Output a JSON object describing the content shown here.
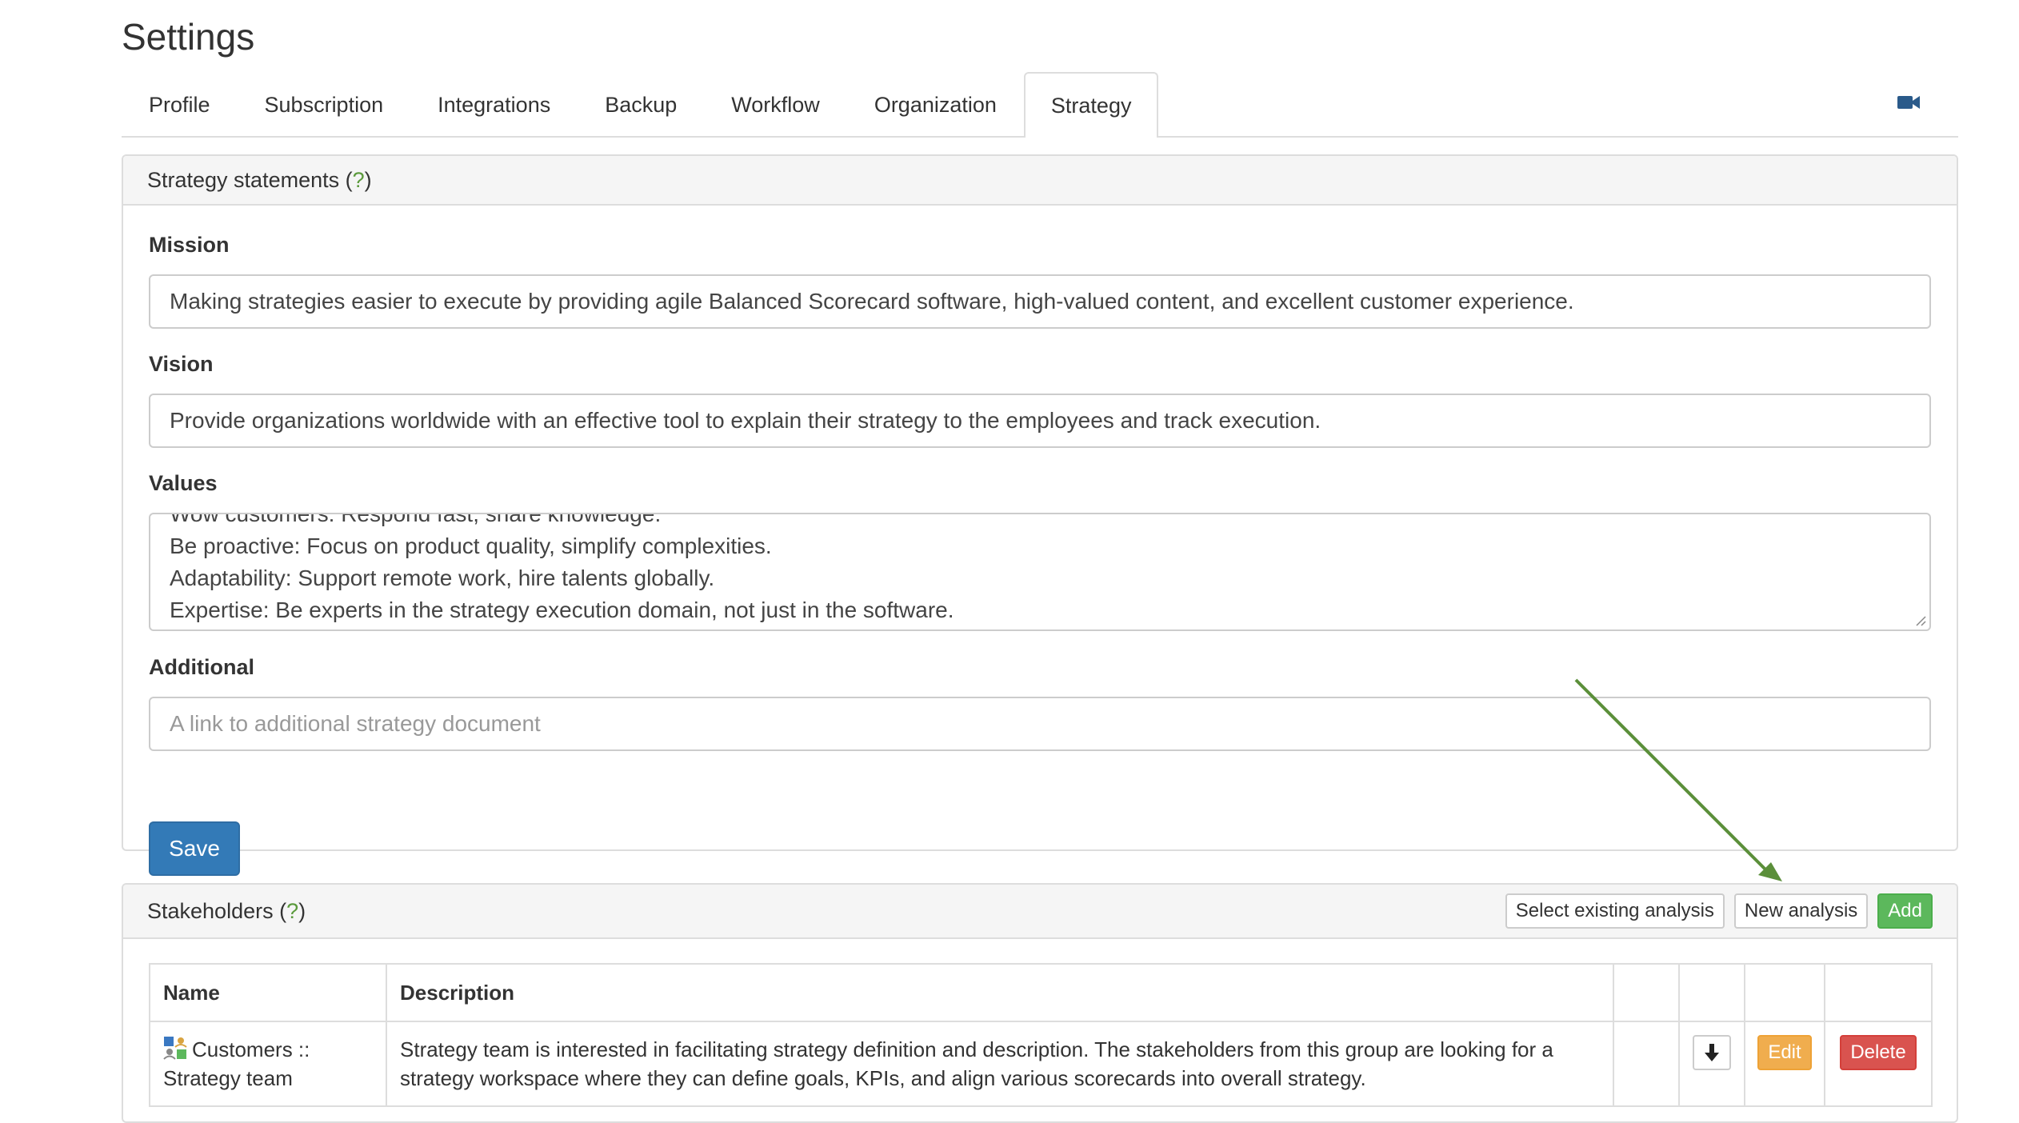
{
  "header": {
    "title": "Settings"
  },
  "tabs": [
    {
      "label": "Profile"
    },
    {
      "label": "Subscription"
    },
    {
      "label": "Integrations"
    },
    {
      "label": "Backup"
    },
    {
      "label": "Workflow"
    },
    {
      "label": "Organization"
    },
    {
      "label": "Strategy",
      "active": true
    }
  ],
  "video_icon": "video-camera-icon",
  "strategy_panel": {
    "heading": "Strategy statements (",
    "help": "?",
    "heading_end": ")",
    "mission_label": "Mission",
    "mission_value": "Making strategies easier to execute by providing agile Balanced Scorecard software, high-valued content, and excellent customer experience.",
    "vision_label": "Vision",
    "vision_value": "Provide organizations worldwide with an effective tool to explain their strategy to the employees and track execution.",
    "values_label": "Values",
    "values_lines": [
      "Wow customers: Respond fast, share knowledge.",
      "Be proactive: Focus on product quality, simplify complexities.",
      "Adaptability: Support remote work, hire talents globally.",
      "Expertise: Be experts in the strategy execution domain, not just in the software."
    ],
    "additional_label": "Additional",
    "additional_placeholder": "A link to additional strategy document",
    "save_label": "Save"
  },
  "stakeholders_panel": {
    "heading": "Stakeholders (",
    "help": "?",
    "heading_end": ")",
    "select_existing_label": "Select existing analysis",
    "new_analysis_label": "New analysis",
    "add_label": "Add",
    "table": {
      "headers": {
        "name": "Name",
        "description": "Description"
      },
      "rows": [
        {
          "name_line1": "Customers ::",
          "name_line2": "Strategy team",
          "description": "Strategy team is interested in facilitating strategy definition and description. The stakeholders from this group are looking for a strategy workspace where they can define goals, KPIs, and align various scorecards into overall strategy.",
          "edit_label": "Edit",
          "delete_label": "Delete"
        }
      ]
    }
  },
  "colors": {
    "primary": "#337ab7",
    "success": "#5cb85c",
    "warning": "#f0ad4e",
    "danger": "#d9534f",
    "annotation_arrow": "#5b8f3a"
  }
}
